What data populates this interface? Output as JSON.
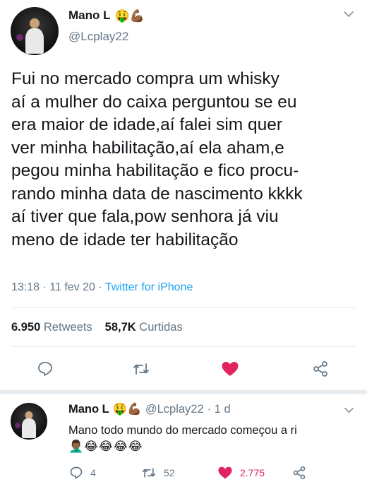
{
  "tweet": {
    "display_name": "Mano L",
    "name_emojis": "🤑💪🏾",
    "handle": "@Lcplay22",
    "text": "Fui no mercado compra um whisky\naí a mulher do caixa perguntou se eu\nera maior de idade,aí falei sim quer\nver minha habilitação,aí ela aham,e\npegou minha habilitação e fico procu-\nrando minha data de nascimento kkkk\naí tiver que fala,pow senhora já viu\nmeno de idade ter habilitação",
    "time": "13:18",
    "date": "11 fev 20",
    "separator": "·",
    "source": "Twitter for iPhone",
    "retweets_count": "6.950",
    "retweets_label": "Retweets",
    "likes_count": "58,7K",
    "likes_label": "Curtidas"
  },
  "reply": {
    "display_name": "Mano L",
    "name_emojis": "🤑💪🏾",
    "handle": "@Lcplay22",
    "time": "· 1 d",
    "text": "Mano todo mundo do mercado começou a ri",
    "emojis": "🤦🏾‍♂️😂😂😂😂",
    "reply_count": "4",
    "retweet_count": "52",
    "like_count": "2.775"
  },
  "colors": {
    "text": "#14171a",
    "secondary": "#657786",
    "link": "#1da1f2",
    "like": "#e0245e",
    "divider": "#e6ecf0"
  },
  "icons": {
    "reply": "speech-bubble-icon",
    "retweet": "retweet-arrows-icon",
    "like": "heart-icon",
    "share": "share-nodes-icon",
    "menu": "chevron-down-icon"
  }
}
